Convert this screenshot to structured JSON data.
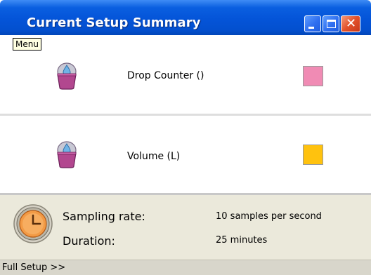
{
  "window": {
    "title": "Current Setup Summary",
    "controls": {
      "minimize": "minimize",
      "maximize": "maximize",
      "close": "close"
    }
  },
  "tooltip": {
    "text": "Menu"
  },
  "sensors": [
    {
      "label": "Drop Counter ()",
      "icon": "drop-counter-icon",
      "color": "#f08bb4"
    },
    {
      "label": "Volume (L)",
      "icon": "drop-counter-icon",
      "color": "#ffc20e"
    }
  ],
  "summary": {
    "icon": "clock-icon",
    "sampling_rate_label": "Sampling rate:",
    "sampling_rate_value": "10 samples per second",
    "duration_label": "Duration:",
    "duration_value": "25 minutes"
  },
  "footer": {
    "full_setup_label": "Full Setup >>"
  }
}
